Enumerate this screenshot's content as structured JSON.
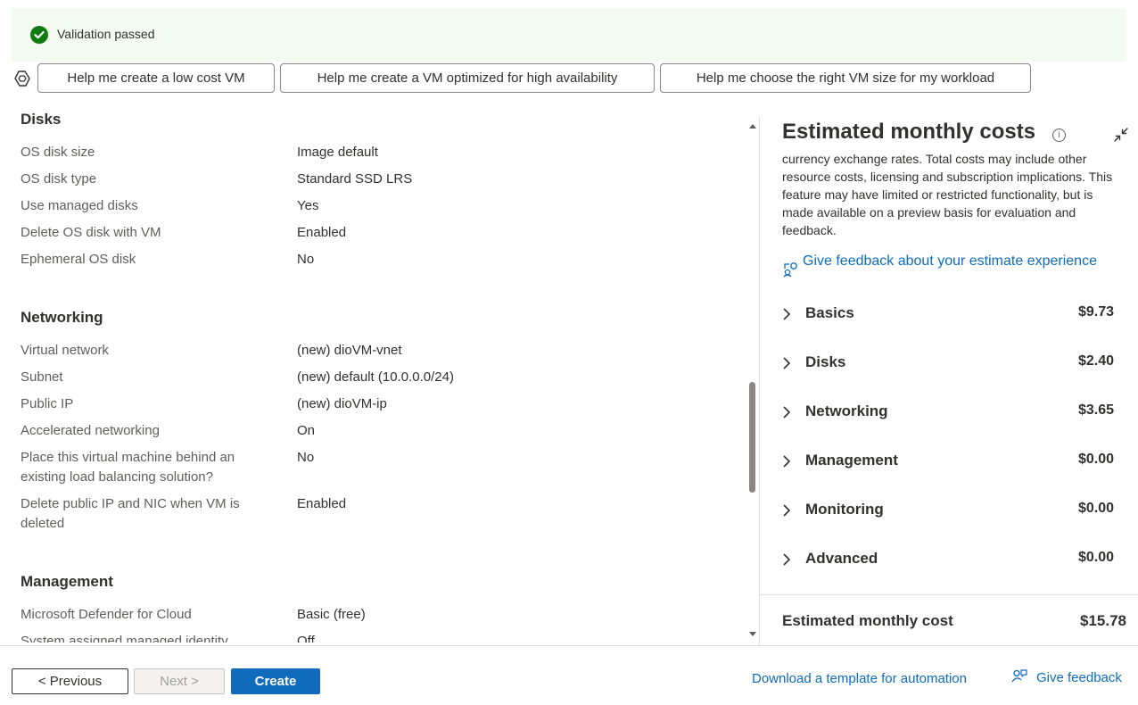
{
  "banner": {
    "text": "Validation passed",
    "status_color": "#107c10"
  },
  "copilot_prompts": [
    "Help me create a low cost VM",
    "Help me create a VM optimized for high availability",
    "Help me choose the right VM size for my workload"
  ],
  "sections": {
    "disks": {
      "title": "Disks",
      "rows": [
        {
          "label": "OS disk size",
          "value": "Image default"
        },
        {
          "label": "OS disk type",
          "value": "Standard SSD LRS"
        },
        {
          "label": "Use managed disks",
          "value": "Yes"
        },
        {
          "label": "Delete OS disk with VM",
          "value": "Enabled"
        },
        {
          "label": "Ephemeral OS disk",
          "value": "No"
        }
      ]
    },
    "networking": {
      "title": "Networking",
      "rows": [
        {
          "label": "Virtual network",
          "value": "(new) dioVM-vnet"
        },
        {
          "label": "Subnet",
          "value": "(new) default (10.0.0.0/24)"
        },
        {
          "label": "Public IP",
          "value": "(new) dioVM-ip"
        },
        {
          "label": "Accelerated networking",
          "value": "On"
        },
        {
          "label": "Place this virtual machine behind an existing load balancing solution?",
          "value": "No"
        },
        {
          "label": "Delete public IP and NIC when VM is deleted",
          "value": "Enabled"
        }
      ]
    },
    "management": {
      "title": "Management",
      "rows": [
        {
          "label": "Microsoft Defender for Cloud",
          "value": "Basic (free)"
        },
        {
          "label": "System assigned managed identity",
          "value": "Off"
        }
      ]
    }
  },
  "cost_panel": {
    "title": "Estimated monthly costs",
    "description": "currency exchange rates. Total costs may include other resource costs, licensing and subscription implications. This feature may have limited or restricted functionality, but is made available on a preview basis for evaluation and feedback.",
    "feedback_link": "Give feedback about your estimate experience",
    "items": [
      {
        "label": "Basics",
        "value": "$9.73"
      },
      {
        "label": "Disks",
        "value": "$2.40"
      },
      {
        "label": "Networking",
        "value": "$3.65"
      },
      {
        "label": "Management",
        "value": "$0.00"
      },
      {
        "label": "Monitoring",
        "value": "$0.00"
      },
      {
        "label": "Advanced",
        "value": "$0.00"
      }
    ],
    "total_label": "Estimated monthly cost",
    "total_value": "$15.78"
  },
  "footer": {
    "previous": "< Previous",
    "next": "Next >",
    "create": "Create",
    "download_link": "Download a template for automation",
    "give_feedback": "Give feedback",
    "accent": "#0f6cbd"
  }
}
